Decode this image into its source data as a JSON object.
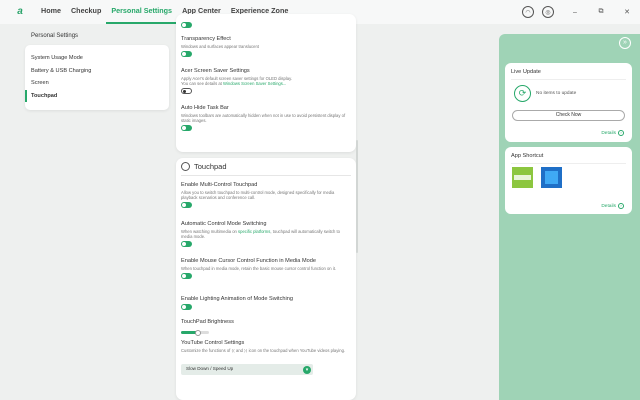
{
  "nav": {
    "items": [
      {
        "label": "Home",
        "active": false
      },
      {
        "label": "Checkup",
        "active": false
      },
      {
        "label": "Personal Settings",
        "active": true
      },
      {
        "label": "App Center",
        "active": false
      },
      {
        "label": "Experience Zone",
        "active": false
      }
    ]
  },
  "window": {
    "minimize": "–",
    "maximize": "⧉",
    "close": "✕"
  },
  "sidebar": {
    "title": "Personal Settings",
    "items": [
      {
        "label": "System Usage Mode"
      },
      {
        "label": "Battery & USB Charging"
      },
      {
        "label": "Screen"
      },
      {
        "label": "Touchpad"
      }
    ]
  },
  "screen": {
    "transparency": {
      "title": "Transparency Effect",
      "desc": "Windows and surfaces appear translucent"
    },
    "saver": {
      "title": "Acer Screen Saver Settings",
      "desc1": "Apply Acer's default screen saver settings for OLED display.",
      "desc2": "You can see details at",
      "link": "Windows Screen Saver Settings..."
    },
    "autohide": {
      "title": "Auto Hide Task Bar",
      "desc": "Windows toolbars are automatically hidden when not in use to avoid persistent display of static images."
    }
  },
  "touchpad": {
    "heading": "Touchpad",
    "multi": {
      "title": "Enable Multi-Control Touchpad",
      "desc": "Allow you to switch touchpad to multi-control mode, designed specifically for media playback scenarios and conference call."
    },
    "auto": {
      "title": "Automatic Control Mode Switching",
      "desc1": "When watching multimedia on",
      "link": "specific platforms",
      "desc2": ", touchpad will automatically switch to media mode."
    },
    "cursor": {
      "title": "Enable Mouse Cursor Control Function in Media Mode",
      "desc": "When touchpad in media mode, retain the basic mouse cursor control function on it."
    },
    "lighting": {
      "title": "Enable Lighting Animation of Mode Switching"
    },
    "brightness": {
      "title": "TouchPad Brightness",
      "level": 0.6
    },
    "youtube": {
      "title": "YouTube Control Settings",
      "desc1": "Customize the functions of",
      "desc2": "and",
      "desc3": "icon on the touchpad when YouTube videos playing.",
      "selected": "Slow Down / Speed Up"
    }
  },
  "right": {
    "update": {
      "title": "Live Update",
      "empty": "No items to update",
      "button": "Check Now",
      "details": "Details"
    },
    "shortcut": {
      "title": "App Shortcut",
      "details": "Details"
    }
  }
}
